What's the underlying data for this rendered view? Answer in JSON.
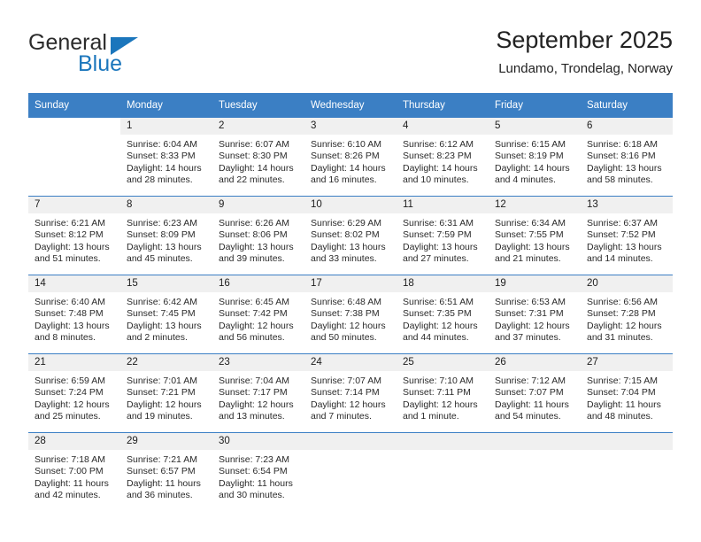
{
  "brand": {
    "name_part1": "General",
    "name_part2": "Blue",
    "triangle_color": "#1b76bc"
  },
  "header": {
    "title": "September 2025",
    "subtitle": "Lundamo, Trondelag, Norway"
  },
  "theme": {
    "header_blue": "#3b7fc4",
    "daynum_gray": "#f0f0f0",
    "separator_blue": "#3b7fc4"
  },
  "labels": {
    "sunrise": "Sunrise:",
    "sunset": "Sunset:",
    "daylight": "Daylight:"
  },
  "weekdays": [
    "Sunday",
    "Monday",
    "Tuesday",
    "Wednesday",
    "Thursday",
    "Friday",
    "Saturday"
  ],
  "weeks": [
    [
      {
        "day": "",
        "sunrise": "",
        "sunset": "",
        "daylight_l1": "",
        "daylight_l2": ""
      },
      {
        "day": "1",
        "sunrise": "Sunrise: 6:04 AM",
        "sunset": "Sunset: 8:33 PM",
        "daylight_l1": "Daylight: 14 hours",
        "daylight_l2": "and 28 minutes."
      },
      {
        "day": "2",
        "sunrise": "Sunrise: 6:07 AM",
        "sunset": "Sunset: 8:30 PM",
        "daylight_l1": "Daylight: 14 hours",
        "daylight_l2": "and 22 minutes."
      },
      {
        "day": "3",
        "sunrise": "Sunrise: 6:10 AM",
        "sunset": "Sunset: 8:26 PM",
        "daylight_l1": "Daylight: 14 hours",
        "daylight_l2": "and 16 minutes."
      },
      {
        "day": "4",
        "sunrise": "Sunrise: 6:12 AM",
        "sunset": "Sunset: 8:23 PM",
        "daylight_l1": "Daylight: 14 hours",
        "daylight_l2": "and 10 minutes."
      },
      {
        "day": "5",
        "sunrise": "Sunrise: 6:15 AM",
        "sunset": "Sunset: 8:19 PM",
        "daylight_l1": "Daylight: 14 hours",
        "daylight_l2": "and 4 minutes."
      },
      {
        "day": "6",
        "sunrise": "Sunrise: 6:18 AM",
        "sunset": "Sunset: 8:16 PM",
        "daylight_l1": "Daylight: 13 hours",
        "daylight_l2": "and 58 minutes."
      }
    ],
    [
      {
        "day": "7",
        "sunrise": "Sunrise: 6:21 AM",
        "sunset": "Sunset: 8:12 PM",
        "daylight_l1": "Daylight: 13 hours",
        "daylight_l2": "and 51 minutes."
      },
      {
        "day": "8",
        "sunrise": "Sunrise: 6:23 AM",
        "sunset": "Sunset: 8:09 PM",
        "daylight_l1": "Daylight: 13 hours",
        "daylight_l2": "and 45 minutes."
      },
      {
        "day": "9",
        "sunrise": "Sunrise: 6:26 AM",
        "sunset": "Sunset: 8:06 PM",
        "daylight_l1": "Daylight: 13 hours",
        "daylight_l2": "and 39 minutes."
      },
      {
        "day": "10",
        "sunrise": "Sunrise: 6:29 AM",
        "sunset": "Sunset: 8:02 PM",
        "daylight_l1": "Daylight: 13 hours",
        "daylight_l2": "and 33 minutes."
      },
      {
        "day": "11",
        "sunrise": "Sunrise: 6:31 AM",
        "sunset": "Sunset: 7:59 PM",
        "daylight_l1": "Daylight: 13 hours",
        "daylight_l2": "and 27 minutes."
      },
      {
        "day": "12",
        "sunrise": "Sunrise: 6:34 AM",
        "sunset": "Sunset: 7:55 PM",
        "daylight_l1": "Daylight: 13 hours",
        "daylight_l2": "and 21 minutes."
      },
      {
        "day": "13",
        "sunrise": "Sunrise: 6:37 AM",
        "sunset": "Sunset: 7:52 PM",
        "daylight_l1": "Daylight: 13 hours",
        "daylight_l2": "and 14 minutes."
      }
    ],
    [
      {
        "day": "14",
        "sunrise": "Sunrise: 6:40 AM",
        "sunset": "Sunset: 7:48 PM",
        "daylight_l1": "Daylight: 13 hours",
        "daylight_l2": "and 8 minutes."
      },
      {
        "day": "15",
        "sunrise": "Sunrise: 6:42 AM",
        "sunset": "Sunset: 7:45 PM",
        "daylight_l1": "Daylight: 13 hours",
        "daylight_l2": "and 2 minutes."
      },
      {
        "day": "16",
        "sunrise": "Sunrise: 6:45 AM",
        "sunset": "Sunset: 7:42 PM",
        "daylight_l1": "Daylight: 12 hours",
        "daylight_l2": "and 56 minutes."
      },
      {
        "day": "17",
        "sunrise": "Sunrise: 6:48 AM",
        "sunset": "Sunset: 7:38 PM",
        "daylight_l1": "Daylight: 12 hours",
        "daylight_l2": "and 50 minutes."
      },
      {
        "day": "18",
        "sunrise": "Sunrise: 6:51 AM",
        "sunset": "Sunset: 7:35 PM",
        "daylight_l1": "Daylight: 12 hours",
        "daylight_l2": "and 44 minutes."
      },
      {
        "day": "19",
        "sunrise": "Sunrise: 6:53 AM",
        "sunset": "Sunset: 7:31 PM",
        "daylight_l1": "Daylight: 12 hours",
        "daylight_l2": "and 37 minutes."
      },
      {
        "day": "20",
        "sunrise": "Sunrise: 6:56 AM",
        "sunset": "Sunset: 7:28 PM",
        "daylight_l1": "Daylight: 12 hours",
        "daylight_l2": "and 31 minutes."
      }
    ],
    [
      {
        "day": "21",
        "sunrise": "Sunrise: 6:59 AM",
        "sunset": "Sunset: 7:24 PM",
        "daylight_l1": "Daylight: 12 hours",
        "daylight_l2": "and 25 minutes."
      },
      {
        "day": "22",
        "sunrise": "Sunrise: 7:01 AM",
        "sunset": "Sunset: 7:21 PM",
        "daylight_l1": "Daylight: 12 hours",
        "daylight_l2": "and 19 minutes."
      },
      {
        "day": "23",
        "sunrise": "Sunrise: 7:04 AM",
        "sunset": "Sunset: 7:17 PM",
        "daylight_l1": "Daylight: 12 hours",
        "daylight_l2": "and 13 minutes."
      },
      {
        "day": "24",
        "sunrise": "Sunrise: 7:07 AM",
        "sunset": "Sunset: 7:14 PM",
        "daylight_l1": "Daylight: 12 hours",
        "daylight_l2": "and 7 minutes."
      },
      {
        "day": "25",
        "sunrise": "Sunrise: 7:10 AM",
        "sunset": "Sunset: 7:11 PM",
        "daylight_l1": "Daylight: 12 hours",
        "daylight_l2": "and 1 minute."
      },
      {
        "day": "26",
        "sunrise": "Sunrise: 7:12 AM",
        "sunset": "Sunset: 7:07 PM",
        "daylight_l1": "Daylight: 11 hours",
        "daylight_l2": "and 54 minutes."
      },
      {
        "day": "27",
        "sunrise": "Sunrise: 7:15 AM",
        "sunset": "Sunset: 7:04 PM",
        "daylight_l1": "Daylight: 11 hours",
        "daylight_l2": "and 48 minutes."
      }
    ],
    [
      {
        "day": "28",
        "sunrise": "Sunrise: 7:18 AM",
        "sunset": "Sunset: 7:00 PM",
        "daylight_l1": "Daylight: 11 hours",
        "daylight_l2": "and 42 minutes."
      },
      {
        "day": "29",
        "sunrise": "Sunrise: 7:21 AM",
        "sunset": "Sunset: 6:57 PM",
        "daylight_l1": "Daylight: 11 hours",
        "daylight_l2": "and 36 minutes."
      },
      {
        "day": "30",
        "sunrise": "Sunrise: 7:23 AM",
        "sunset": "Sunset: 6:54 PM",
        "daylight_l1": "Daylight: 11 hours",
        "daylight_l2": "and 30 minutes."
      },
      {
        "day": "",
        "sunrise": "",
        "sunset": "",
        "daylight_l1": "",
        "daylight_l2": ""
      },
      {
        "day": "",
        "sunrise": "",
        "sunset": "",
        "daylight_l1": "",
        "daylight_l2": ""
      },
      {
        "day": "",
        "sunrise": "",
        "sunset": "",
        "daylight_l1": "",
        "daylight_l2": ""
      },
      {
        "day": "",
        "sunrise": "",
        "sunset": "",
        "daylight_l1": "",
        "daylight_l2": ""
      }
    ]
  ]
}
